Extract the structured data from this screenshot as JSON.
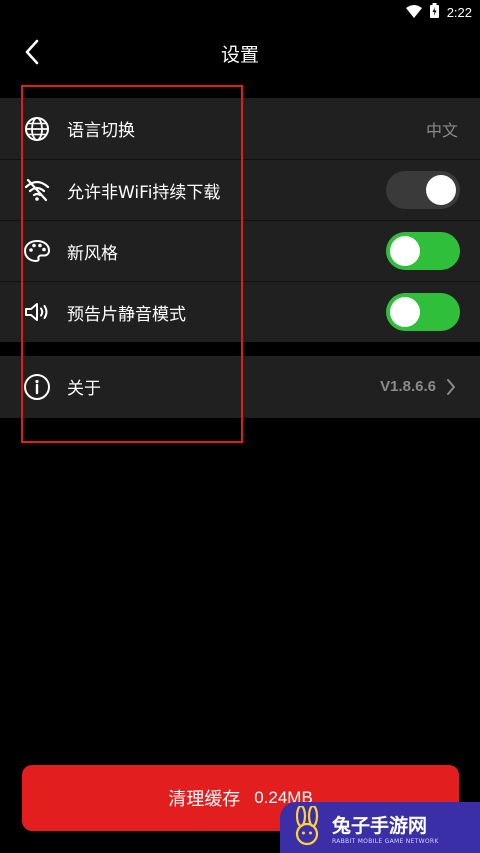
{
  "status_bar": {
    "time": "2:22"
  },
  "header": {
    "title": "设置"
  },
  "settings": {
    "language": {
      "label": "语言切换",
      "value": "中文"
    },
    "wifi_download": {
      "label": "允许非WiFi持续下载",
      "enabled": false
    },
    "new_style": {
      "label": "新风格",
      "enabled": true
    },
    "trailer_mute": {
      "label": "预告片静音模式",
      "enabled": true
    },
    "about": {
      "label": "关于",
      "version": "V1.8.6.6"
    }
  },
  "clear_cache": {
    "label": "清理缓存",
    "size": "0.24MB"
  },
  "watermark": {
    "title": "兔子手游网",
    "subtitle": "RABBIT MOBILE GAME NETWORK"
  },
  "colors": {
    "accent_red": "#e31e1e",
    "toggle_on": "#2fbf3a",
    "toggle_off": "#3a3a3a",
    "row_bg": "#202020"
  }
}
